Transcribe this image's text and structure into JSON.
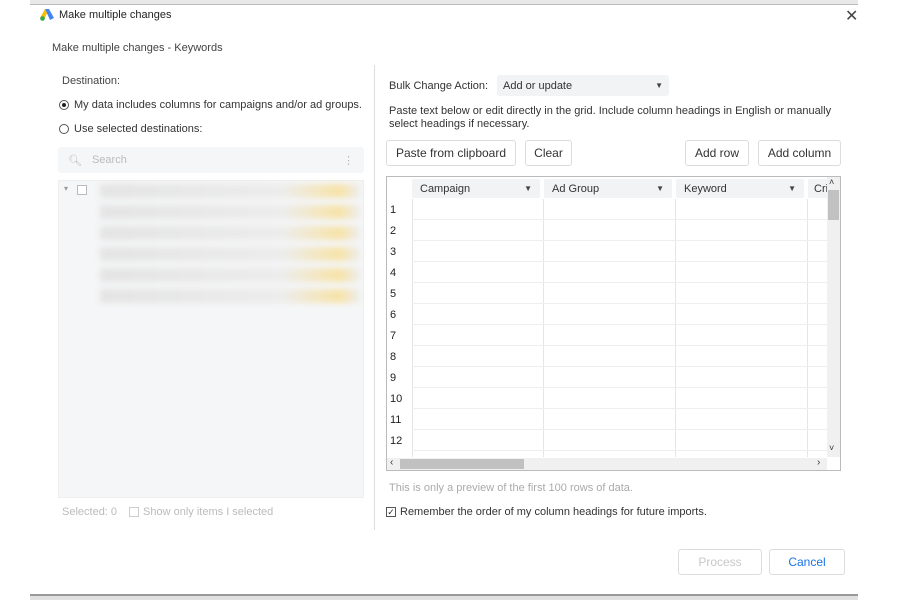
{
  "window": {
    "title": "Make multiple changes",
    "subtitle": "Make multiple changes - Keywords",
    "close_icon": "close-icon"
  },
  "destination": {
    "label": "Destination:",
    "options": [
      {
        "label": "My data includes columns for campaigns and/or ad groups.",
        "selected": true
      },
      {
        "label": "Use selected destinations:",
        "selected": false
      }
    ],
    "search_placeholder": "Search",
    "selected_count": "Selected: 0",
    "show_only_selected": "Show only items I selected"
  },
  "bulk": {
    "label": "Bulk Change Action:",
    "value": "Add or update"
  },
  "instructions": "Paste text below or edit directly in the grid. Include column headings in English or manually select headings if necessary.",
  "toolbar": {
    "paste": "Paste from clipboard",
    "clear": "Clear",
    "add_row": "Add row",
    "add_column": "Add column"
  },
  "grid": {
    "columns": [
      "Campaign",
      "Ad Group",
      "Keyword",
      "Cri"
    ],
    "rows": [
      "1",
      "2",
      "3",
      "4",
      "5",
      "6",
      "7",
      "8",
      "9",
      "10",
      "11",
      "12"
    ]
  },
  "preview_note": "This is only a preview of the first 100 rows of data.",
  "remember": {
    "label": "Remember the order of my column headings for future imports.",
    "checked": true
  },
  "footer": {
    "process": "Process",
    "cancel": "Cancel"
  },
  "colors": {
    "accent": "#1a73e8",
    "disabled": "#c8c8c8"
  }
}
